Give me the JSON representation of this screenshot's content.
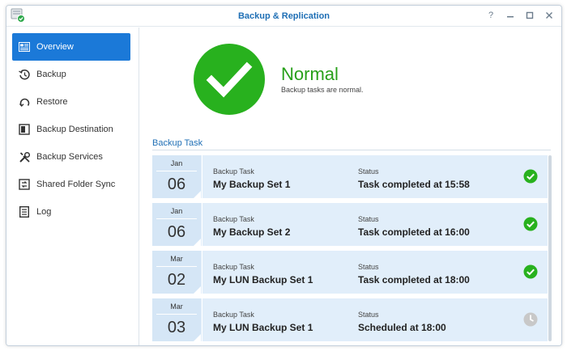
{
  "window": {
    "title": "Backup & Replication",
    "controls": [
      "help-icon",
      "minimize-icon",
      "maximize-icon",
      "close-icon"
    ]
  },
  "sidebar": {
    "items": [
      {
        "label": "Overview",
        "icon": "overview-icon",
        "active": true
      },
      {
        "label": "Backup",
        "icon": "backup-clock-icon",
        "active": false
      },
      {
        "label": "Restore",
        "icon": "restore-icon",
        "active": false
      },
      {
        "label": "Backup Destination",
        "icon": "backup-destination-icon",
        "active": false
      },
      {
        "label": "Backup Services",
        "icon": "tools-icon",
        "active": false
      },
      {
        "label": "Shared Folder Sync",
        "icon": "folder-sync-icon",
        "active": false
      },
      {
        "label": "Log",
        "icon": "log-icon",
        "active": false
      }
    ]
  },
  "status": {
    "title": "Normal",
    "description": "Backup tasks are normal.",
    "color": "#28b11e"
  },
  "section": {
    "title": "Backup Task"
  },
  "tasks": [
    {
      "month": "Jan",
      "day": "06",
      "task_label": "Backup Task",
      "task_name": "My Backup Set 1",
      "status_label": "Status",
      "status_text": "Task completed at 15:58",
      "state": "success"
    },
    {
      "month": "Jan",
      "day": "06",
      "task_label": "Backup Task",
      "task_name": "My Backup Set 2",
      "status_label": "Status",
      "status_text": "Task completed at 16:00",
      "state": "success"
    },
    {
      "month": "Mar",
      "day": "02",
      "task_label": "Backup Task",
      "task_name": "My LUN Backup Set 1",
      "status_label": "Status",
      "status_text": "Task completed at 18:00",
      "state": "success"
    },
    {
      "month": "Mar",
      "day": "03",
      "task_label": "Backup Task",
      "task_name": "My LUN Backup Set 1",
      "status_label": "Status",
      "status_text": "Scheduled at 18:00",
      "state": "scheduled"
    }
  ],
  "colors": {
    "accent": "#1b79d8",
    "success": "#28b11e",
    "scheduled": "#c8c8c8"
  }
}
